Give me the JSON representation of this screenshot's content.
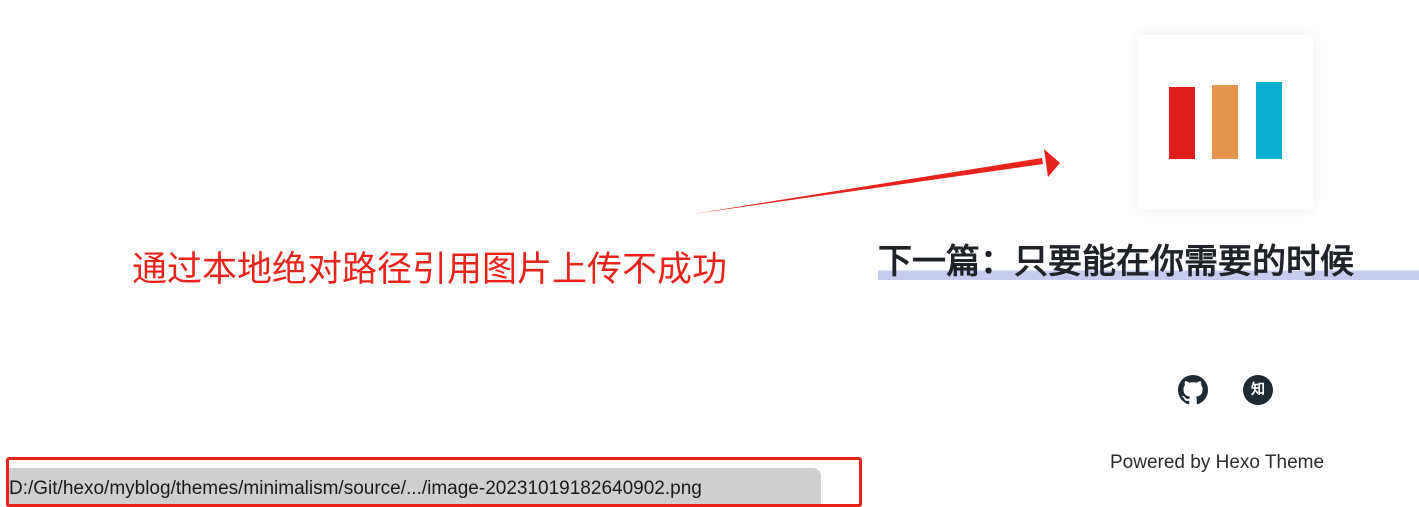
{
  "annotation": {
    "text": "通过本地绝对路径引用图片上传不成功",
    "color": "#e8231b"
  },
  "image_card": {
    "bars": [
      {
        "color": "#e01b1b"
      },
      {
        "color": "#e5944c"
      },
      {
        "color": "#08afd1"
      }
    ]
  },
  "next_post": {
    "label": "下一篇：只要能在你需要的时候"
  },
  "social": {
    "github_icon": "github-icon",
    "zhihu_icon": "zhihu-icon",
    "zhihu_glyph": "知"
  },
  "footer": {
    "text": "Powered by Hexo Theme"
  },
  "status_bar": {
    "url": "D:/Git/hexo/myblog/themes/minimalism/source/.../image-20231019182640902.png"
  }
}
